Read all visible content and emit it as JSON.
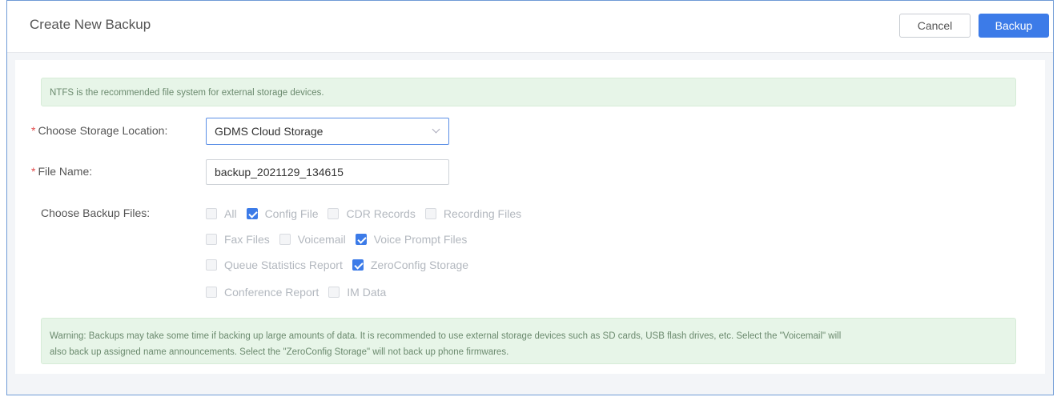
{
  "header": {
    "title": "Create New Backup",
    "cancel_label": "Cancel",
    "backup_label": "Backup"
  },
  "notice_top": "NTFS is the recommended file system for external storage devices.",
  "storage_location": {
    "label": "Choose Storage Location:",
    "value": "GDMS Cloud Storage"
  },
  "file_name": {
    "label": "File Name:",
    "value": "backup_2021129_134615"
  },
  "backup_files": {
    "label": "Choose Backup Files:",
    "rows": [
      [
        {
          "label": "All",
          "checked": false
        },
        {
          "label": "Config File",
          "checked": true
        },
        {
          "label": "CDR Records",
          "checked": false
        },
        {
          "label": "Recording Files",
          "checked": false
        }
      ],
      [
        {
          "label": "Fax Files",
          "checked": false
        },
        {
          "label": "Voicemail",
          "checked": false
        },
        {
          "label": "Voice Prompt Files",
          "checked": true
        }
      ],
      [
        {
          "label": "Queue Statistics Report",
          "checked": false
        },
        {
          "label": "ZeroConfig Storage",
          "checked": true
        }
      ],
      [
        {
          "label": "Conference Report",
          "checked": false
        },
        {
          "label": "IM Data",
          "checked": false
        }
      ]
    ]
  },
  "warning": {
    "line1": "Warning: Backups may take some time if backing up large amounts of data. It is recommended to use external storage devices such as SD cards, USB flash drives, etc. Select the \"Voicemail\" will",
    "line2": "also back up assigned name announcements. Select the \"ZeroConfig Storage\" will not back up phone firmwares."
  },
  "colors": {
    "accent": "#3c7be8",
    "required": "#e14b4b",
    "notice_bg": "#e7f5e8"
  }
}
